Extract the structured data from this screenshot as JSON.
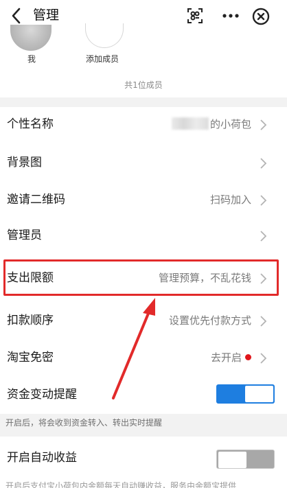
{
  "header": {
    "title": "管理"
  },
  "icons": {
    "back": "chevron-left-icon",
    "scan": "scan-icon",
    "more": "more-icon",
    "close": "close-circle-icon"
  },
  "members": {
    "me_label": "我",
    "add_label": "添加成员",
    "total": "共1位成员"
  },
  "settings": [
    {
      "label": "个性名称",
      "value": "的小荷包"
    },
    {
      "label": "背景图",
      "value": ""
    },
    {
      "label": "邀请二维码",
      "value": "扫码加入"
    },
    {
      "label": "管理员",
      "value": ""
    },
    {
      "label": "支出限额",
      "value": "管理预算，不乱花钱"
    },
    {
      "label": "扣款顺序",
      "value": "设置优先付款方式"
    },
    {
      "label": "淘宝免密",
      "value": "去开启"
    },
    {
      "label": "资金变动提醒",
      "toggle": true
    },
    {
      "label": "开启自动收益",
      "toggle": false
    }
  ],
  "hints": {
    "fund_notice": "开启后，将会收到资金转入、转出实时提醒",
    "auto_income": "开启后支付宝小荷包内金额每天自动赚收益，服务由余额宝提供"
  },
  "colors": {
    "accent": "#1e7ee0",
    "highlight": "#e22a2a",
    "badge": "#e0161b"
  }
}
